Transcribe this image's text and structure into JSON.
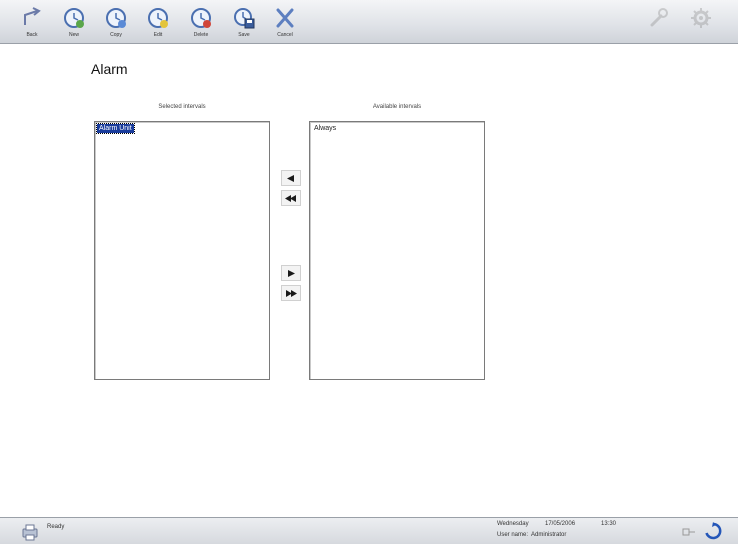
{
  "toolbar": {
    "back_label": "Back",
    "new_label": "New",
    "copy_label": "Copy",
    "edit_label": "Edit",
    "delete_label": "Delete",
    "save_label": "Save",
    "cancel_label": "Cancel"
  },
  "page": {
    "title": "Alarm"
  },
  "selected": {
    "caption": "Selected intervals",
    "items": [
      "Alarm Unit"
    ]
  },
  "available": {
    "caption": "Available intervals",
    "items": [
      "Always"
    ]
  },
  "status": {
    "text": "Ready",
    "day": "Wednesday",
    "date": "17/05/2006",
    "time": "13:30",
    "user_label": "User name:",
    "user": "Administrator"
  },
  "colors": {
    "selection": "#1a3c9c",
    "arrow": "#1a1a1a"
  }
}
